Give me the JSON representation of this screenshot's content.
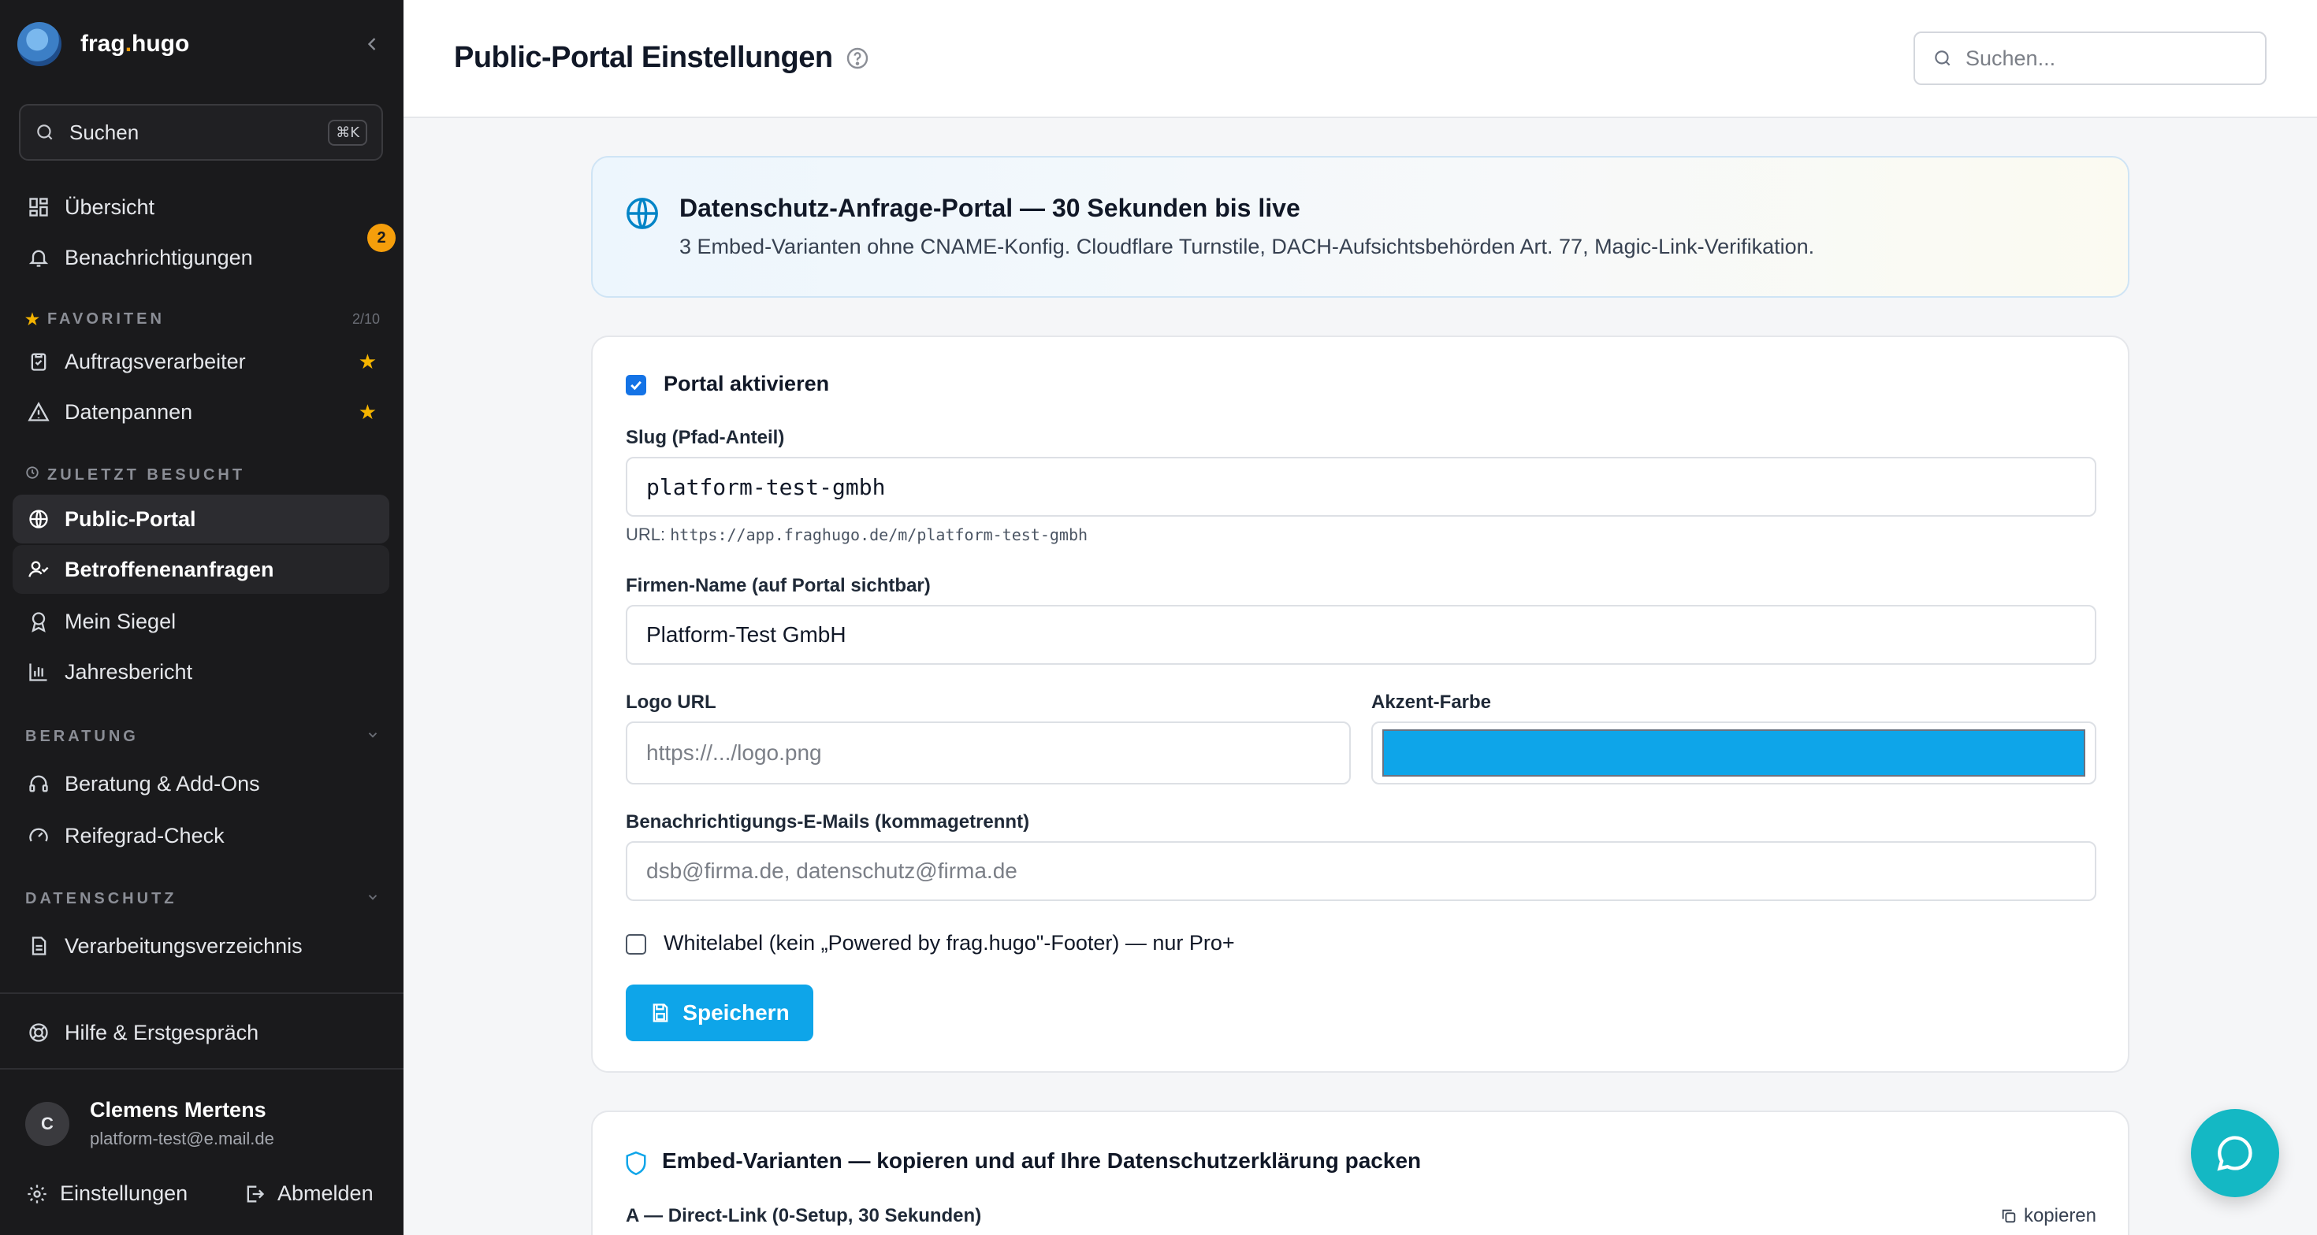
{
  "sidebar": {
    "brand": {
      "prefix": "frag",
      "dot": ".",
      "suffix": "hugo"
    },
    "search": {
      "label": "Suchen",
      "shortcut": "⌘K"
    },
    "main_items": [
      {
        "label": "Übersicht",
        "icon": "grid-icon"
      },
      {
        "label": "Benachrichtigungen",
        "icon": "bell-icon",
        "badge": "2"
      }
    ],
    "favorites": {
      "title": "FAVORITEN",
      "count": "2/10",
      "items": [
        {
          "label": "Auftragsverarbeiter",
          "icon": "clipboard-check-icon"
        },
        {
          "label": "Datenpannen",
          "icon": "warning-icon"
        }
      ]
    },
    "recent": {
      "title": "ZULETZT BESUCHT",
      "items": [
        {
          "label": "Public-Portal",
          "icon": "globe-icon"
        },
        {
          "label": "Betroffenenanfragen",
          "icon": "user-check-icon"
        },
        {
          "label": "Mein Siegel",
          "icon": "award-icon"
        },
        {
          "label": "Jahresbericht",
          "icon": "bar-chart-icon"
        }
      ]
    },
    "beratung": {
      "title": "BERATUNG",
      "items": [
        {
          "label": "Beratung & Add-Ons",
          "icon": "headphones-icon"
        },
        {
          "label": "Reifegrad-Check",
          "icon": "gauge-icon"
        }
      ]
    },
    "datenschutz": {
      "title": "DATENSCHUTZ",
      "items": [
        {
          "label": "Verarbeitungsverzeichnis",
          "icon": "file-list-icon"
        }
      ]
    },
    "help": {
      "label": "Hilfe & Erstgespräch",
      "icon": "help-circle-icon"
    },
    "user": {
      "initial": "C",
      "name": "Clemens Mertens",
      "email": "platform-test@e.mail.de"
    },
    "settings_label": "Einstellungen",
    "logout_label": "Abmelden"
  },
  "header": {
    "title": "Public-Portal Einstellungen",
    "search_placeholder": "Suchen..."
  },
  "banner": {
    "title": "Datenschutz-Anfrage-Portal — 30 Sekunden bis live",
    "subtitle": "3 Embed-Varianten ohne CNAME-Konfig. Cloudflare Turnstile, DACH-Aufsichtsbehörden Art. 77, Magic-Link-Verifikation."
  },
  "form": {
    "activate_label": "Portal aktivieren",
    "activate_checked": true,
    "slug_label": "Slug (Pfad-Anteil)",
    "slug_value": "platform-test-gmbh",
    "url_prefix": "URL:",
    "url_value": "https://app.fraghugo.de/m/platform-test-gmbh",
    "company_label": "Firmen-Name (auf Portal sichtbar)",
    "company_value": "Platform-Test GmbH",
    "logo_label": "Logo URL",
    "logo_placeholder": "https://.../logo.png",
    "accent_label": "Akzent-Farbe",
    "accent_color": "#0ea5e9",
    "emails_label": "Benachrichtigungs-E-Mails (kommagetrennt)",
    "emails_placeholder": "dsb@firma.de, datenschutz@firma.de",
    "whitelabel_label": "Whitelabel (kein „Powered by frag.hugo\"-Footer) — nur Pro+",
    "whitelabel_checked": false,
    "save_label": "Speichern"
  },
  "embed": {
    "title": "Embed-Varianten — kopieren und auf Ihre Datenschutzerklärung packen",
    "variant_a": "A — Direct-Link (0-Setup, 30 Sekunden)",
    "copy_label": "kopieren"
  },
  "colors": {
    "primary": "#0ea5e9",
    "sidebar_bg": "#1a1a1c",
    "badge": "#f59e0b",
    "chat": "#14b8c4"
  }
}
